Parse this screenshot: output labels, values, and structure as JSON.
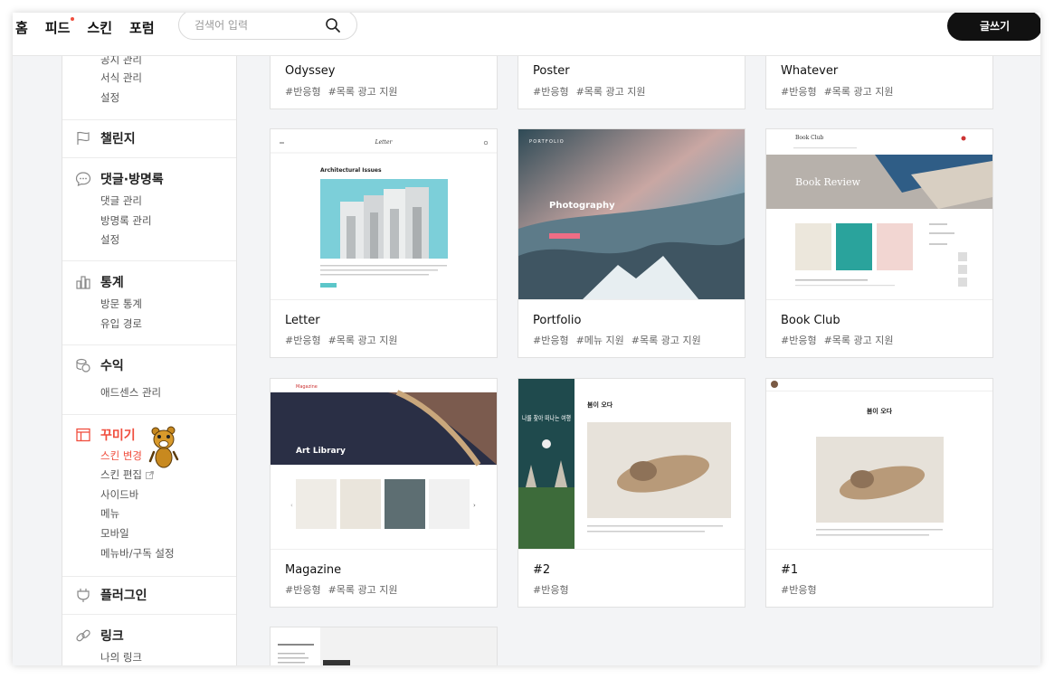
{
  "topbar": {
    "nav": [
      "홈",
      "피드",
      "스킨",
      "포럼"
    ],
    "search_placeholder": "검색어 입력",
    "write_label": "글쓰기",
    "notify_color": "#f04e3e"
  },
  "sidebar": {
    "partial_top": {
      "items": [
        "공지 관리",
        "서식 관리",
        "설정"
      ]
    },
    "challenge": {
      "title": "챌린지",
      "icon": "flag-icon"
    },
    "comments": {
      "title": "댓글·방명록",
      "icon": "speech-bubble-icon",
      "items": [
        "댓글 관리",
        "방명록 관리",
        "설정"
      ]
    },
    "stats": {
      "title": "통계",
      "icon": "bar-chart-icon",
      "items": [
        "방문 통계",
        "유입 경로"
      ]
    },
    "revenue": {
      "title": "수익",
      "icon": "coins-icon",
      "items": [
        "애드센스 관리"
      ]
    },
    "decorate": {
      "title": "꾸미기",
      "icon": "layout-icon",
      "items": [
        "스킨 변경",
        "스킨 편집",
        "사이드바",
        "메뉴",
        "모바일",
        "메뉴바/구독 설정"
      ]
    },
    "plugin": {
      "title": "플러그인",
      "icon": "plug-icon"
    },
    "link": {
      "title": "링크",
      "icon": "link-icon",
      "items": [
        "나의 링크"
      ]
    },
    "accent_color": "#f04e3e"
  },
  "thumbs": {
    "letter": {
      "brand": "Letter",
      "heading": "Architectural Issues"
    },
    "portfolio": {
      "brand": "PORTFOLIO",
      "heading": "Photography"
    },
    "bookclub": {
      "brand": "Book Club",
      "banner": "Book Review"
    },
    "magazine": {
      "brand": "Magazine",
      "banner": "Art Library"
    },
    "two": {
      "side_text": "나를 찾아 떠나는 여행",
      "heading": "봄이 오다"
    },
    "one": {
      "heading": "봄이 오다"
    }
  },
  "cards": [
    {
      "name": "Odyssey",
      "tags": [
        "#반응형",
        "#목록 광고 지원"
      ]
    },
    {
      "name": "Poster",
      "tags": [
        "#반응형",
        "#목록 광고 지원"
      ]
    },
    {
      "name": "Whatever",
      "tags": [
        "#반응형",
        "#목록 광고 지원"
      ]
    },
    {
      "name": "Letter",
      "tags": [
        "#반응형",
        "#목록 광고 지원"
      ]
    },
    {
      "name": "Portfolio",
      "tags": [
        "#반응형",
        "#메뉴 지원",
        "#목록 광고 지원"
      ]
    },
    {
      "name": "Book Club",
      "tags": [
        "#반응형",
        "#목록 광고 지원"
      ]
    },
    {
      "name": "Magazine",
      "tags": [
        "#반응형",
        "#목록 광고 지원"
      ]
    },
    {
      "name": "#2",
      "tags": [
        "#반응형"
      ]
    },
    {
      "name": "#1",
      "tags": [
        "#반응형"
      ]
    }
  ]
}
